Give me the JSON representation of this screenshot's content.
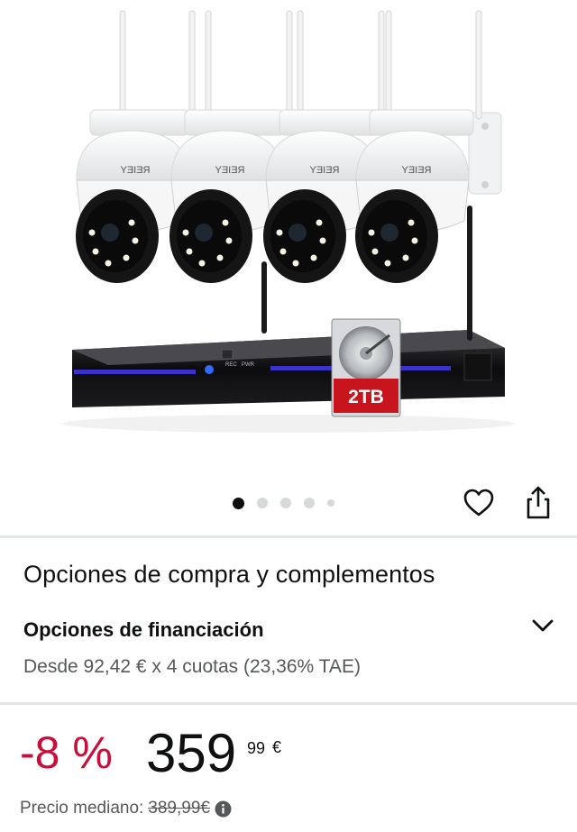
{
  "product": {
    "image_alt": "Kit de 4 cámaras REIGY con grabador NVR y disco duro 2TB",
    "camera_brand": "REIGY",
    "hdd_label": "2TB",
    "camera_count": 4
  },
  "carousel": {
    "total": 5,
    "active_index": 0
  },
  "icons": {
    "wishlist": "heart-icon",
    "share": "share-icon",
    "expand": "chevron-down-icon",
    "info": "info-icon"
  },
  "purchase_options": {
    "title": "Opciones de compra y complementos",
    "financing_title": "Opciones de financiación",
    "financing_detail": "Desde 92,42 € x 4 cuotas (23,36% TAE)"
  },
  "price": {
    "discount": "-8 %",
    "whole": "359",
    "fraction": "99",
    "currency": "€",
    "median_label": "Precio mediano:",
    "median_value": "389,99€"
  },
  "colors": {
    "discount_red": "#cc0c39",
    "text_primary": "#0f1111",
    "text_secondary": "#565959",
    "divider": "#e3e6e6"
  }
}
